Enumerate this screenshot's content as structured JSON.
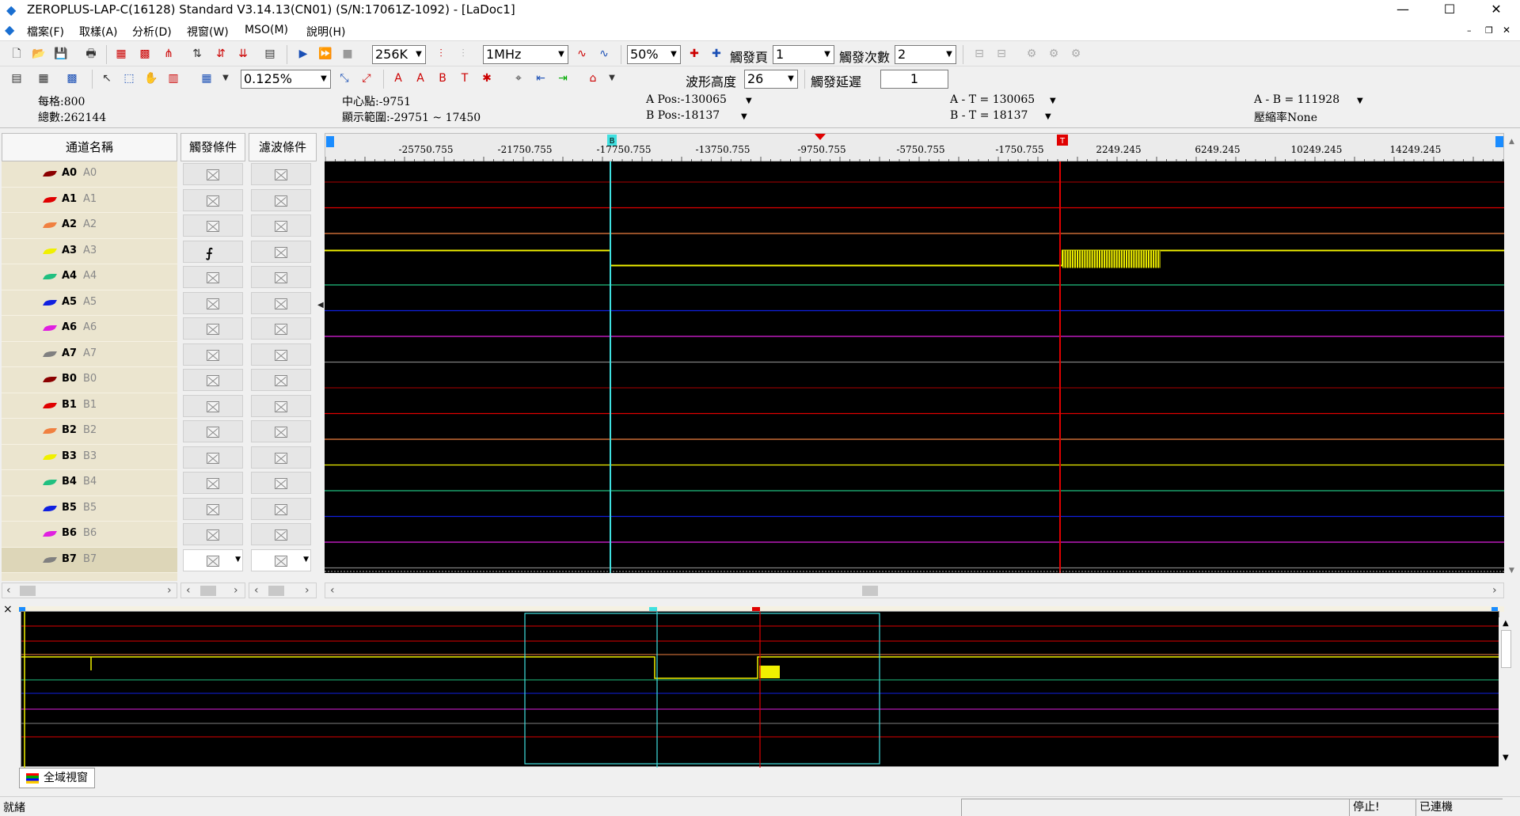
{
  "window": {
    "title": "ZEROPLUS-LAP-C(16128) Standard V3.14.13(CN01) (S/N:17061Z-1092) - [LaDoc1]",
    "minimize": "—",
    "maximize": "☐",
    "close": "✕"
  },
  "menu": [
    "檔案(F)",
    "取樣(A)",
    "分析(D)",
    "視窗(W)",
    "MSO(M)",
    "說明(H)"
  ],
  "toolbar1": {
    "memory_depth": "256K",
    "sample_rate": "1MHz",
    "trigger_position": "50%",
    "trigger_page_label": "觸發頁",
    "trigger_page": "1",
    "trigger_count_label": "觸發次數",
    "trigger_count": "2"
  },
  "toolbar2": {
    "zoom": "0.125%",
    "waveform_height_label": "波形高度",
    "waveform_height": "26",
    "trigger_delay_label": "觸發延遲",
    "trigger_delay": "1"
  },
  "info": {
    "per_div": "每格:800",
    "total": "總數:262144",
    "center": "中心點:-9751",
    "range": "顯示範圍:-29751 ~ 17450",
    "a_pos": "A Pos:-130065",
    "b_pos": "B Pos:-18137",
    "a_t": "A - T = 130065",
    "b_t": "B - T = 18137",
    "a_b": "A - B = 111928",
    "compression": "壓縮率None"
  },
  "table": {
    "name_header": "通道名稱",
    "trigger_header": "觸發條件",
    "filter_header": "濾波條件",
    "channels": [
      {
        "name": "A0",
        "alias": "A0",
        "color": "#8b0000",
        "trigger": "x"
      },
      {
        "name": "A1",
        "alias": "A1",
        "color": "#e00000",
        "trigger": "x"
      },
      {
        "name": "A2",
        "alias": "A2",
        "color": "#f08040",
        "trigger": "x"
      },
      {
        "name": "A3",
        "alias": "A3",
        "color": "#f0f000",
        "trigger": "rise"
      },
      {
        "name": "A4",
        "alias": "A4",
        "color": "#20c080",
        "trigger": "x"
      },
      {
        "name": "A5",
        "alias": "A5",
        "color": "#1020e0",
        "trigger": "x"
      },
      {
        "name": "A6",
        "alias": "A6",
        "color": "#e020e0",
        "trigger": "x"
      },
      {
        "name": "A7",
        "alias": "A7",
        "color": "#808080",
        "trigger": "x"
      },
      {
        "name": "B0",
        "alias": "B0",
        "color": "#8b0000",
        "trigger": "x"
      },
      {
        "name": "B1",
        "alias": "B1",
        "color": "#e00000",
        "trigger": "x"
      },
      {
        "name": "B2",
        "alias": "B2",
        "color": "#f08040",
        "trigger": "x"
      },
      {
        "name": "B3",
        "alias": "B3",
        "color": "#f0f000",
        "trigger": "x"
      },
      {
        "name": "B4",
        "alias": "B4",
        "color": "#20c080",
        "trigger": "x"
      },
      {
        "name": "B5",
        "alias": "B5",
        "color": "#1020e0",
        "trigger": "x"
      },
      {
        "name": "B6",
        "alias": "B6",
        "color": "#e020e0",
        "trigger": "x"
      },
      {
        "name": "B7",
        "alias": "B7",
        "color": "#808080",
        "trigger": "x"
      }
    ]
  },
  "ruler": {
    "ticks": [
      "-25750.755",
      "-21750.755",
      "-17750.755",
      "-13750.755",
      "-9750.755",
      "-5750.755",
      "-1750.755",
      "2249.245",
      "6249.245",
      "10249.245",
      "14249.245"
    ],
    "cursor_b_label": "B",
    "cursor_t_label": "T"
  },
  "overview": {
    "tab_label": "全域視窗",
    "close": "×"
  },
  "status": {
    "ready": "就緒",
    "state": "停止!",
    "connection": "已連機"
  },
  "colors": {
    "cursor_b": "#40e0e0",
    "trigger_cursor": "#e00000",
    "trace": "#f0f000"
  }
}
